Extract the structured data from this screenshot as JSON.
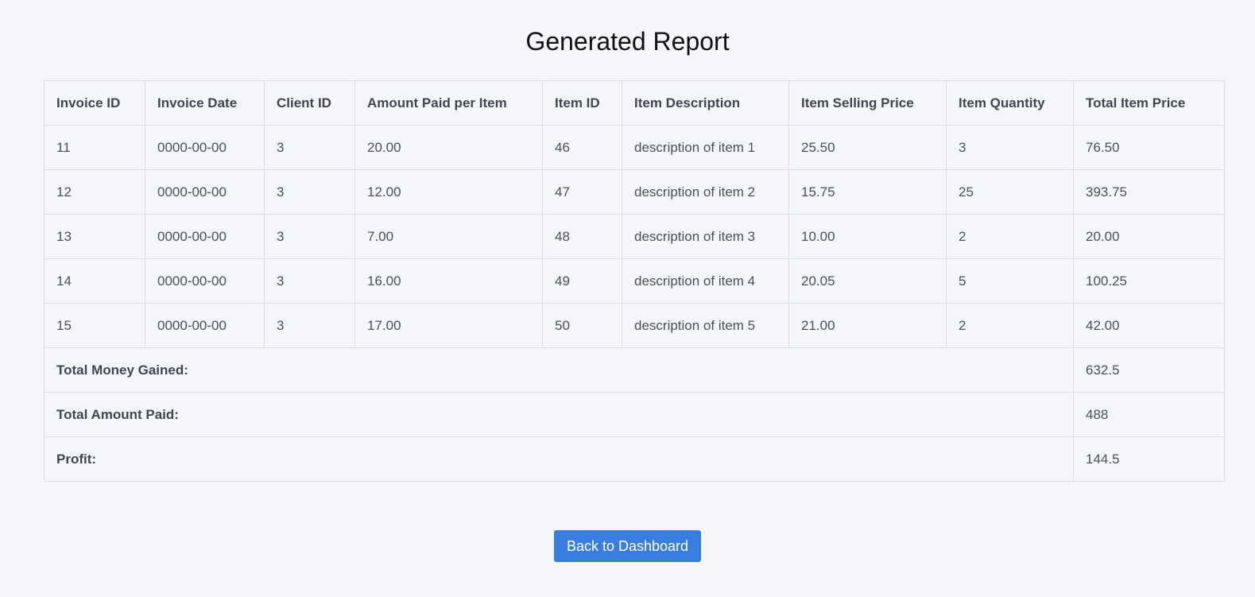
{
  "page": {
    "title": "Generated Report"
  },
  "table": {
    "headers": [
      "Invoice ID",
      "Invoice Date",
      "Client ID",
      "Amount Paid per Item",
      "Item ID",
      "Item Description",
      "Item Selling Price",
      "Item Quantity",
      "Total Item Price"
    ],
    "rows": [
      [
        "11",
        "0000-00-00",
        "3",
        "20.00",
        "46",
        "description of item 1",
        "25.50",
        "3",
        "76.50"
      ],
      [
        "12",
        "0000-00-00",
        "3",
        "12.00",
        "47",
        "description of item 2",
        "15.75",
        "25",
        "393.75"
      ],
      [
        "13",
        "0000-00-00",
        "3",
        "7.00",
        "48",
        "description of item 3",
        "10.00",
        "2",
        "20.00"
      ],
      [
        "14",
        "0000-00-00",
        "3",
        "16.00",
        "49",
        "description of item 4",
        "20.05",
        "5",
        "100.25"
      ],
      [
        "15",
        "0000-00-00",
        "3",
        "17.00",
        "50",
        "description of item 5",
        "21.00",
        "2",
        "42.00"
      ]
    ],
    "summary": [
      {
        "label": "Total Money Gained:",
        "value": "632.5"
      },
      {
        "label": "Total Amount Paid:",
        "value": "488"
      },
      {
        "label": "Profit:",
        "value": "144.5"
      }
    ]
  },
  "actions": {
    "back_label": "Back to Dashboard"
  },
  "colors": {
    "background": "#f5f6fa",
    "accent": "#3a7de0",
    "border": "#dcdfe4"
  }
}
